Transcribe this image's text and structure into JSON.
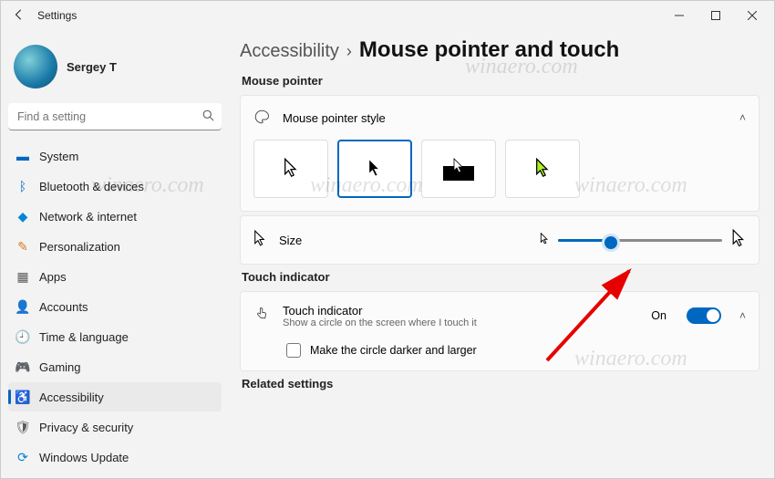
{
  "window": {
    "title": "Settings"
  },
  "user": {
    "name": "Sergey T"
  },
  "search": {
    "placeholder": "Find a setting"
  },
  "nav": {
    "items": [
      {
        "label": "System"
      },
      {
        "label": "Bluetooth & devices"
      },
      {
        "label": "Network & internet"
      },
      {
        "label": "Personalization"
      },
      {
        "label": "Apps"
      },
      {
        "label": "Accounts"
      },
      {
        "label": "Time & language"
      },
      {
        "label": "Gaming"
      },
      {
        "label": "Accessibility"
      },
      {
        "label": "Privacy & security"
      },
      {
        "label": "Windows Update"
      }
    ]
  },
  "breadcrumb": {
    "parent": "Accessibility",
    "current": "Mouse pointer and touch"
  },
  "sections": {
    "mouse_pointer": "Mouse pointer",
    "touch_indicator": "Touch indicator",
    "related": "Related settings"
  },
  "pointer_style": {
    "label": "Mouse pointer style"
  },
  "size": {
    "label": "Size",
    "value_pct": 35
  },
  "touch": {
    "label": "Touch indicator",
    "sub": "Show a circle on the screen where I touch it",
    "state": "On",
    "option": "Make the circle darker and larger"
  },
  "watermark": "winaero.com"
}
